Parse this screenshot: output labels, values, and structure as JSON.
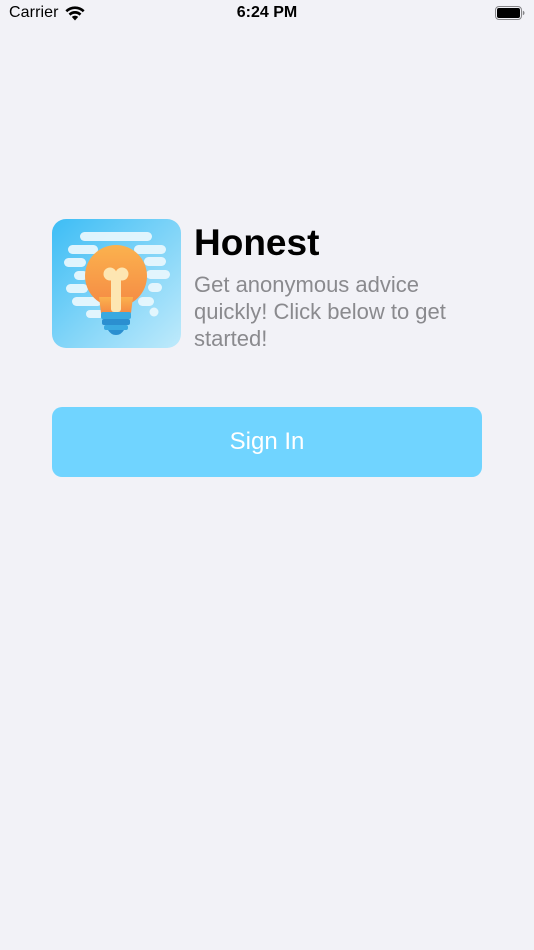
{
  "status_bar": {
    "carrier": "Carrier",
    "time": "6:24 PM",
    "icons": [
      "wifi-icon",
      "battery-icon"
    ]
  },
  "app": {
    "logo_icon": "lightbulb-icon",
    "title": "Honest",
    "subtitle": "Get anonymous advice quickly! Click below to get started!"
  },
  "actions": {
    "sign_in_label": "Sign In"
  },
  "colors": {
    "background": "#f2f2f7",
    "button": "#70d4ff",
    "subtitle": "#8a8a8e",
    "logo_gradient_start": "#4cc3f6",
    "logo_gradient_end": "#b7e9fb",
    "bulb_orange": "#f9a44a",
    "bulb_base": "#3aa9e0"
  }
}
